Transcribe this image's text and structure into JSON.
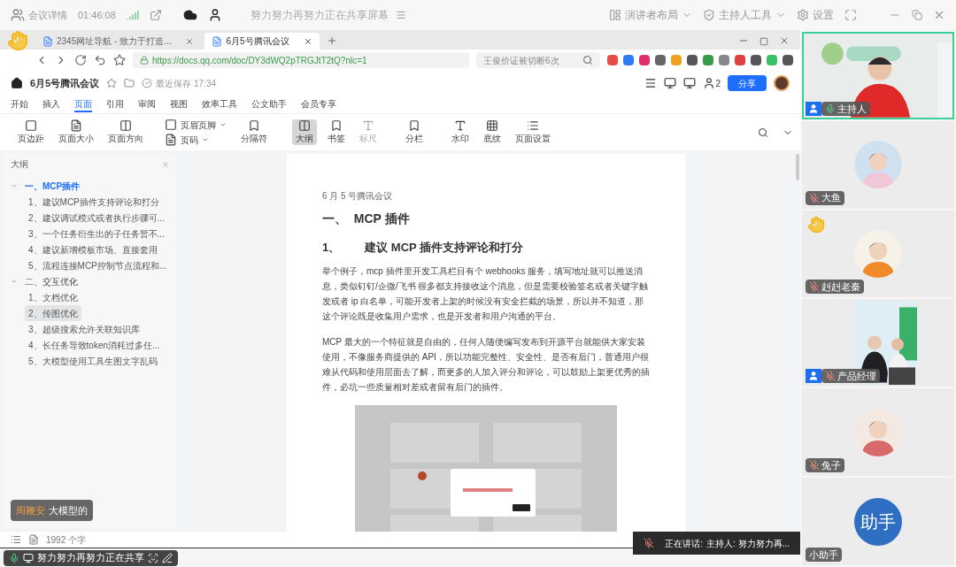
{
  "meeting_bar": {
    "app_label": "会议详情",
    "timer": "01:46:08",
    "share_title": "努力努力再努力正在共享屏幕",
    "layout": "演讲者布局",
    "host_tools": "主持人工具",
    "settings": "设置"
  },
  "browser": {
    "tabs": [
      {
        "title": "2345网址导航 - 致力于打造...",
        "selected": false
      },
      {
        "title": "6月5号腾讯会议",
        "selected": true
      }
    ],
    "url": "https://docs.qq.com/doc/DY3dWQ2pTRGJtT2tQ?nlc=1",
    "search_placeholder": "王俊价证被切断6次"
  },
  "doc_header": {
    "title": "6月5号腾讯会议",
    "save_status": "最近保存 17:34",
    "collaborators": "2",
    "share_button": "分享"
  },
  "menu_tabs": [
    {
      "label": "开始",
      "selected": false
    },
    {
      "label": "插入",
      "selected": false
    },
    {
      "label": "页面",
      "selected": true
    },
    {
      "label": "引用",
      "selected": false
    },
    {
      "label": "审阅",
      "selected": false
    },
    {
      "label": "视图",
      "selected": false
    },
    {
      "label": "效率工具",
      "selected": false
    },
    {
      "label": "公文助手",
      "selected": false
    },
    {
      "label": "会员专享",
      "selected": false
    }
  ],
  "toolbar": [
    [
      {
        "label": "页边距",
        "kind": "column",
        "selected": false,
        "disabled": false
      },
      {
        "label": "页面大小",
        "kind": "column",
        "selected": false,
        "disabled": false
      },
      {
        "label": "页面方向",
        "kind": "column",
        "selected": false,
        "disabled": false
      }
    ],
    [
      {
        "label": "页眉页脚",
        "kind": "row",
        "selected": false,
        "disabled": false
      },
      {
        "label": "页码",
        "kind": "row",
        "selected": false,
        "disabled": false
      },
      {
        "label": "分隔符",
        "kind": "column",
        "selected": false,
        "disabled": false
      }
    ],
    [
      {
        "label": "大纲",
        "kind": "column",
        "selected": true,
        "disabled": false
      },
      {
        "label": "书签",
        "kind": "column",
        "selected": false,
        "disabled": false
      },
      {
        "label": "标尺",
        "kind": "column",
        "selected": false,
        "disabled": true
      }
    ],
    [
      {
        "label": "分栏",
        "kind": "column",
        "selected": false,
        "disabled": false
      }
    ],
    [
      {
        "label": "水印",
        "kind": "column",
        "selected": false,
        "disabled": false
      },
      {
        "label": "底纹",
        "kind": "column",
        "selected": false,
        "disabled": false
      },
      {
        "label": "页面设置",
        "kind": "column",
        "selected": false,
        "disabled": false
      }
    ]
  ],
  "outline": {
    "title": "大纲",
    "sections": [
      {
        "title": "一、MCP插件",
        "expanded": true,
        "selected": true,
        "children": [
          {
            "title": "1、建议MCP插件支持评论和打分",
            "selected": false
          },
          {
            "title": "2、建议调试模式或者执行步骤可...",
            "selected": false
          },
          {
            "title": "3、一个任务衍生出的子任务暂不...",
            "selected": false
          },
          {
            "title": "4、建议新增模板市场、直接套用",
            "selected": false
          },
          {
            "title": "5、流程连接MCP控制节点流程和...",
            "selected": false
          }
        ]
      },
      {
        "title": "二、交互优化",
        "expanded": true,
        "selected": false,
        "children": [
          {
            "title": "1、文档优化",
            "selected": false
          },
          {
            "title": "2、传图优化",
            "selected": true
          },
          {
            "title": "3、超级搜索允许关联知识库",
            "selected": false
          },
          {
            "title": "4、长任务导致token消耗过多任...",
            "selected": false
          },
          {
            "title": "5、大模型使用工具生图文字乱码",
            "selected": false
          }
        ]
      }
    ]
  },
  "document": {
    "header": "6 月 5 号腾讯会议",
    "heading_1": "一、  MCP 插件",
    "heading_2_number": "1、",
    "heading_2": "建议 MCP 插件支持评论和打分",
    "paragraphs": [
      "举个例子，mcp 插件里开发工具栏目有个 webhooks 服务，填写地址就可以推送消息，类似钉钉/企微/飞书 很多都支持接收这个消息，但是需要校验签名或者关键字触发或者 ip 白名单，可能开发者上架的时候没有安全拦截的场景，所以并不知道，那这个评论既是收集用户需求，也是开发者和用户沟通的平台。",
      "MCP 最大的一个特征就是自由的，任何人随便编写发布到开源平台就能供大家安装使用，不像服务商提供的 API，所以功能完整性、安全性、是否有后门，普通用户很难从代码和使用层面去了解，而更多的人加入评分和评论，可以鼓励上架更优秀的插件，必坑一些质量相对差或者留有后门的插件。"
    ]
  },
  "status_bar": {
    "word_count": "1992 个字"
  },
  "caption": {
    "speaker": "周鞭安",
    "text": "大模型的"
  },
  "share_bar": {
    "text": "努力努力再努力正在共享"
  },
  "speaking": {
    "label": "正在讲话:",
    "names": "主持人: 努力努力再..."
  },
  "participants": [
    {
      "name": "主持人",
      "kind": "video",
      "cohost": true,
      "muted": false,
      "speaking": true,
      "hand_raised": false
    },
    {
      "name": "大鱼",
      "kind": "avatar",
      "cohost": false,
      "muted": true,
      "speaking": false,
      "hand_raised": false
    },
    {
      "name": "赳赳老秦",
      "kind": "avatar",
      "cohost": false,
      "muted": true,
      "speaking": false,
      "hand_raised": true
    },
    {
      "name": "产品经理",
      "kind": "video",
      "cohost": true,
      "muted": true,
      "speaking": false,
      "hand_raised": false
    },
    {
      "name": "兔子",
      "kind": "avatar",
      "cohost": false,
      "muted": true,
      "speaking": false,
      "hand_raised": false
    },
    {
      "name": "小助手",
      "kind": "text_avatar",
      "avatar_text": "助手",
      "cohost": false,
      "muted": false,
      "speaking": false,
      "hand_raised": false
    }
  ]
}
